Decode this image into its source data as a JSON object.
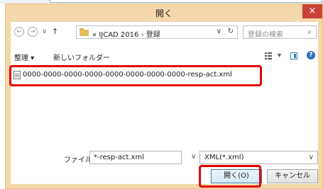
{
  "dialog": {
    "title": "開く",
    "close_glyph": "×"
  },
  "nav": {
    "back_glyph": "←",
    "forward_glyph": "→",
    "history_glyph": "∨",
    "up_glyph": "↑",
    "address": {
      "overflow": "«",
      "segment_1": "IJCAD 2016",
      "separator": "›",
      "segment_2": "登録",
      "drop_glyph": "∨",
      "refresh_glyph": "↻"
    },
    "search_placeholder": "登録の検索",
    "search_glyph": "⌕"
  },
  "toolbar": {
    "organize_label": "整理 ▾",
    "new_folder_label": "新しいフォルダー",
    "view_drop": "▾",
    "help_glyph": "?"
  },
  "files": [
    {
      "name": "0000-0000-0000-0000-0000-0000-0000-0000-resp-act.xml"
    }
  ],
  "bottom": {
    "filename_label": "ファイル名(N):",
    "filename_value": "*-resp-act.xml",
    "filename_drop": "∨",
    "filetype_value": "XML(*.xml)",
    "filetype_drop": "∨",
    "open_button": "開く(O)",
    "cancel_button": "キャンセル"
  },
  "colors": {
    "dialog_frame": "#f4d7ab",
    "close_button": "#c9423a",
    "highlight": "#e30000"
  }
}
